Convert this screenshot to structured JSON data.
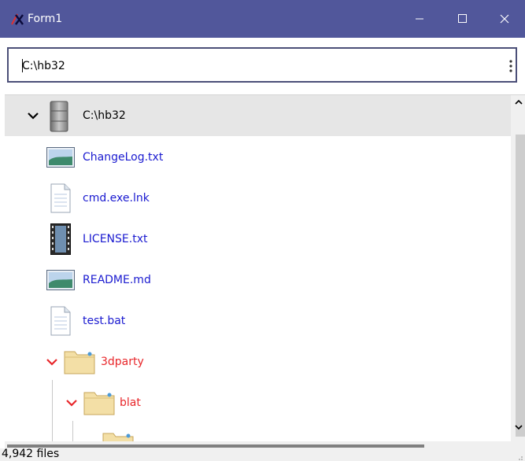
{
  "window": {
    "title": "Form1"
  },
  "address": {
    "value": "C:\\hb32"
  },
  "tree": {
    "root": {
      "label": "C:\\hb32"
    },
    "files": [
      {
        "label": "ChangeLog.txt",
        "icon": "image-file-icon"
      },
      {
        "label": "cmd.exe.lnk",
        "icon": "text-file-icon"
      },
      {
        "label": "LICENSE.txt",
        "icon": "video-file-icon"
      },
      {
        "label": "README.md",
        "icon": "image-file-icon"
      },
      {
        "label": "test.bat",
        "icon": "text-file-icon"
      }
    ],
    "folders": [
      {
        "label": "3dparty",
        "icon": "folder-icon"
      },
      {
        "label": "blat",
        "icon": "folder-icon"
      }
    ]
  },
  "status": {
    "text": "4,942 files"
  },
  "colors": {
    "titlebar": "#51579b",
    "file_label": "#1a1ad0",
    "folder_label": "#e8262a",
    "selected_row": "#e6e6e6"
  }
}
